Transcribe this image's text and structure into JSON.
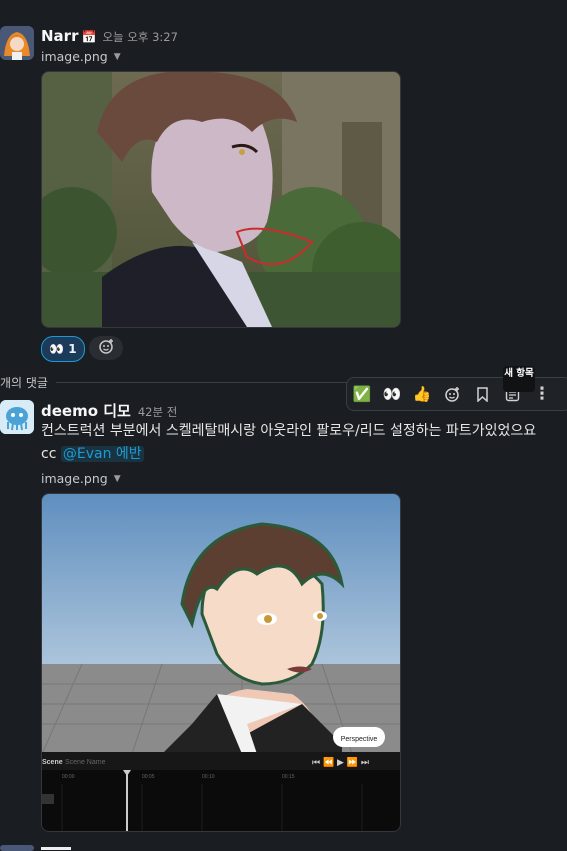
{
  "message1": {
    "author": "Narr",
    "author_badge": "📅",
    "time": "오늘 오후 3:27",
    "file_label": "image.png",
    "reactions": [
      {
        "emoji": "👀",
        "count": "1"
      },
      {
        "emoji": "add-reaction-icon",
        "count": ""
      }
    ]
  },
  "thread": {
    "divider_label": "개의 댓글"
  },
  "toolbar": {
    "items": [
      "✅",
      "👀",
      "👍",
      "add-reaction-icon",
      "bookmark-icon",
      "new-item-icon",
      "more-vertical-icon"
    ],
    "tooltip": "새 항목"
  },
  "message2": {
    "author": "deemo 디모",
    "time": "42분 전",
    "text": "컨스트럭션 부분에서 스켈레탈매시랑 아웃라인 팔로우/리드 설정하는 파트가있었으요",
    "cc_prefix": "cc",
    "mention": "@Evan 에반",
    "file_label": "image.png",
    "scene_ui": {
      "view_mode": "Perspective",
      "scene_label": "Scene",
      "scene_name": "Scene Name",
      "timecodes": [
        "00:00",
        "00:05",
        "00:10",
        "00:15"
      ]
    }
  }
}
